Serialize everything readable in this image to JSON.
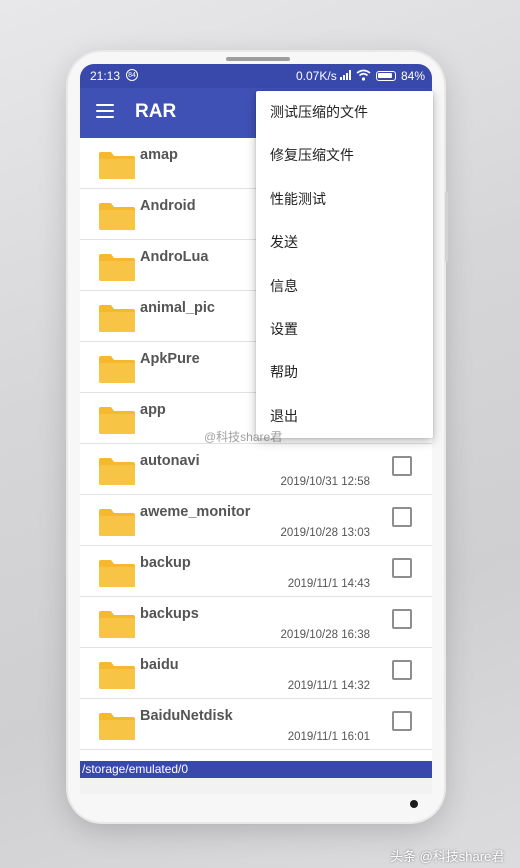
{
  "status_bar": {
    "time": "21:13",
    "notification_badge": "84",
    "net_speed": "0.07K/s",
    "battery": "84%"
  },
  "app_bar": {
    "title": "RAR",
    "menu_icon": "hamburger-menu-icon"
  },
  "files": [
    {
      "name": "amap",
      "date": ""
    },
    {
      "name": "Android",
      "date": ""
    },
    {
      "name": "AndroLua",
      "date": ""
    },
    {
      "name": "animal_pic",
      "date": ""
    },
    {
      "name": "ApkPure",
      "date": ""
    },
    {
      "name": "app",
      "date": ""
    },
    {
      "name": "autonavi",
      "date": "2019/10/31 12:58"
    },
    {
      "name": "aweme_monitor",
      "date": "2019/10/28 13:03"
    },
    {
      "name": "backup",
      "date": "2019/11/1 14:43"
    },
    {
      "name": "backups",
      "date": "2019/10/28 16:38"
    },
    {
      "name": "baidu",
      "date": "2019/11/1 14:32"
    },
    {
      "name": "BaiduNetdisk",
      "date": "2019/11/1 16:01"
    }
  ],
  "path": "/storage/emulated/0",
  "menu": {
    "items": [
      "测试压缩的文件",
      "修复压缩文件",
      "性能测试",
      "发送",
      "信息",
      "设置",
      "帮助",
      "退出"
    ]
  },
  "overlay": {
    "watermark": "@科技share君",
    "caption": "头条 @科技share君"
  },
  "colors": {
    "status_bar": "#3949ab",
    "app_bar": "#3f51b5",
    "folder": "#f5b82e"
  }
}
